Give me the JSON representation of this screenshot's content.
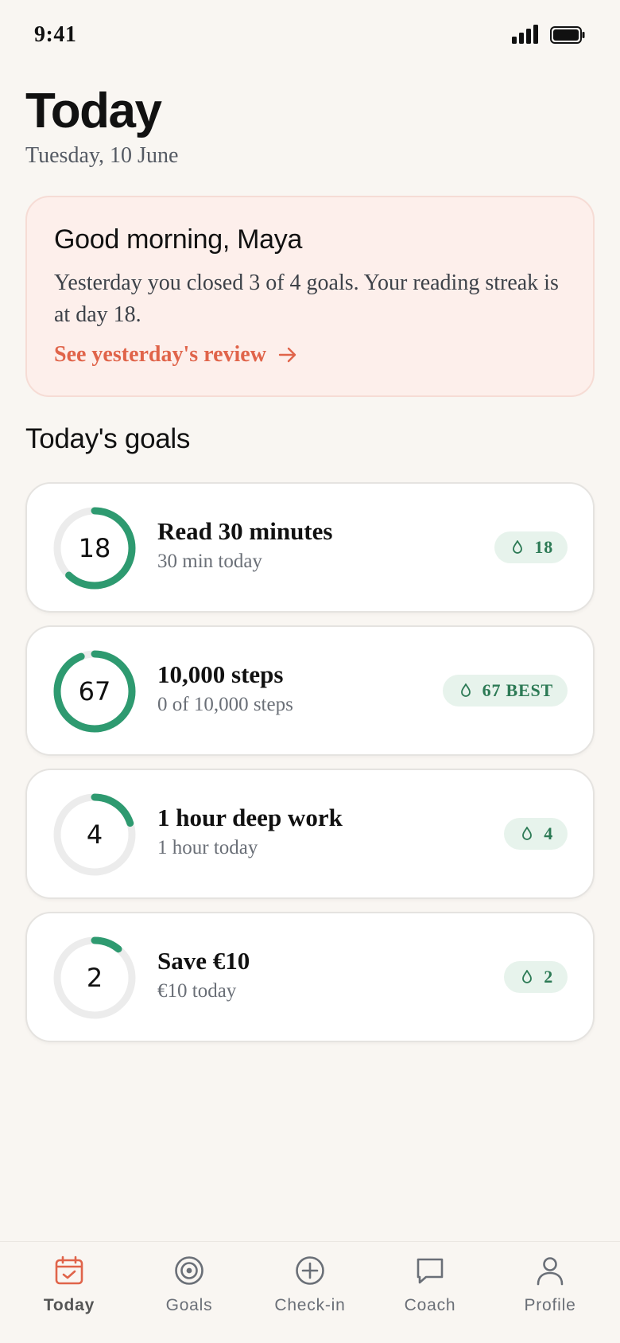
{
  "status_bar": {
    "time": "9:41"
  },
  "header": {
    "title": "Today",
    "date": "Tuesday, 10 June"
  },
  "greeting": {
    "title": "Good morning, Maya",
    "body": "Yesterday you closed 3 of 4 goals. Your reading streak is at day 18.",
    "link": "See yesterday's review"
  },
  "section": {
    "title": "Today's goals"
  },
  "goals": [
    {
      "ring_value": "18",
      "progress": 0.62,
      "title": "Read 30 minutes",
      "subtitle": "30 min today",
      "streak": "18"
    },
    {
      "ring_value": "67",
      "progress": 0.94,
      "title": "10,000 steps",
      "subtitle": "0 of 10,000 steps",
      "streak": "67 BEST"
    },
    {
      "ring_value": "4",
      "progress": 0.2,
      "title": "1 hour deep work",
      "subtitle": "1 hour today",
      "streak": "4"
    },
    {
      "ring_value": "2",
      "progress": 0.11,
      "title": "Save €10",
      "subtitle": "€10 today",
      "streak": "2"
    }
  ],
  "nav": [
    {
      "label": "Today",
      "icon": "calendar-check-icon",
      "active": true
    },
    {
      "label": "Goals",
      "icon": "target-icon",
      "active": false
    },
    {
      "label": "Check-in",
      "icon": "plus-circle-icon",
      "active": false
    },
    {
      "label": "Coach",
      "icon": "chat-bubble-icon",
      "active": false
    },
    {
      "label": "Profile",
      "icon": "person-icon",
      "active": false
    }
  ],
  "colors": {
    "accent": "#e0644a",
    "ring": "#2e9a70",
    "ring_track": "#ececec",
    "badge_bg": "#e7f3ec",
    "badge_text": "#2c7a55"
  }
}
